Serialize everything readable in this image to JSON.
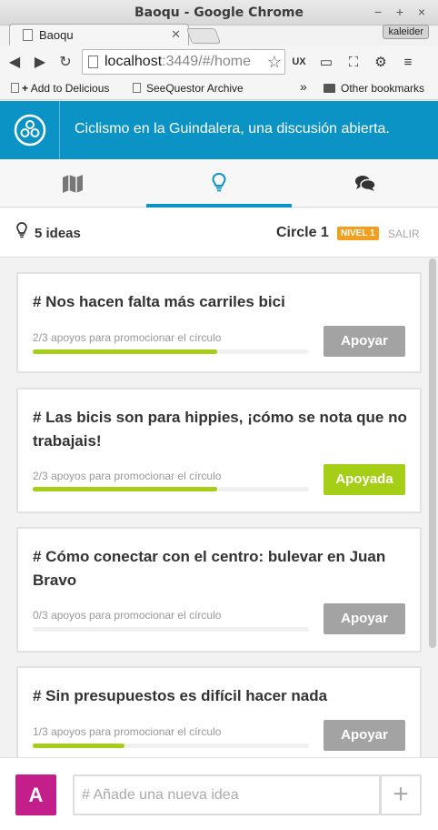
{
  "browser": {
    "window_title": "Baoqu - Google Chrome",
    "tab_title": "Baoqu",
    "profile_name": "kaleider",
    "url_host": "localhost",
    "url_path": ":3449/#/home",
    "bookmarks": [
      "Add to Delicious",
      "SeeQuestor Archive"
    ],
    "bookmarks_overflow": "»",
    "other_bookmarks": "Other bookmarks"
  },
  "app": {
    "title": "Ciclismo en la Guindalera, una discusión abierta.",
    "accent_color": "#0a93c4",
    "tabs": [
      {
        "icon": "map-icon",
        "active": false
      },
      {
        "icon": "lightbulb-icon",
        "active": true
      },
      {
        "icon": "chat-icon",
        "active": false
      }
    ]
  },
  "subheader": {
    "ideas_count": "5 ideas",
    "circle_name": "Circle 1",
    "level_badge": "NIVEL 1",
    "exit_label": "SALIR"
  },
  "ideas": [
    {
      "title": "# Nos hacen falta más carriles bici",
      "progress_text": "2/3 apoyos para promocionar el círculo",
      "progress": 0.667,
      "button": "Apoyar",
      "supported": false
    },
    {
      "title": "# Las bicis son para hippies, ¡cómo se nota que no trabajais!",
      "progress_text": "2/3 apoyos para promocionar el círculo",
      "progress": 0.667,
      "button": "Apoyada",
      "supported": true
    },
    {
      "title": "# Cómo conectar con el centro: bulevar en Juan Bravo",
      "progress_text": "0/3 apoyos para promocionar el círculo",
      "progress": 0,
      "button": "Apoyar",
      "supported": false
    },
    {
      "title": "# Sin presupuestos es difícil hacer nada",
      "progress_text": "1/3 apoyos para promocionar el círculo",
      "progress": 0.333,
      "button": "Apoyar",
      "supported": false
    }
  ],
  "footer": {
    "avatar_letter": "A",
    "input_placeholder": "# Añade una nueva idea",
    "add_label": "+"
  },
  "colors": {
    "supported_button": "#a6ce17",
    "unsupported_button": "#a3a3a3",
    "avatar": "#c41e8b",
    "level_badge": "#f29f1d"
  }
}
